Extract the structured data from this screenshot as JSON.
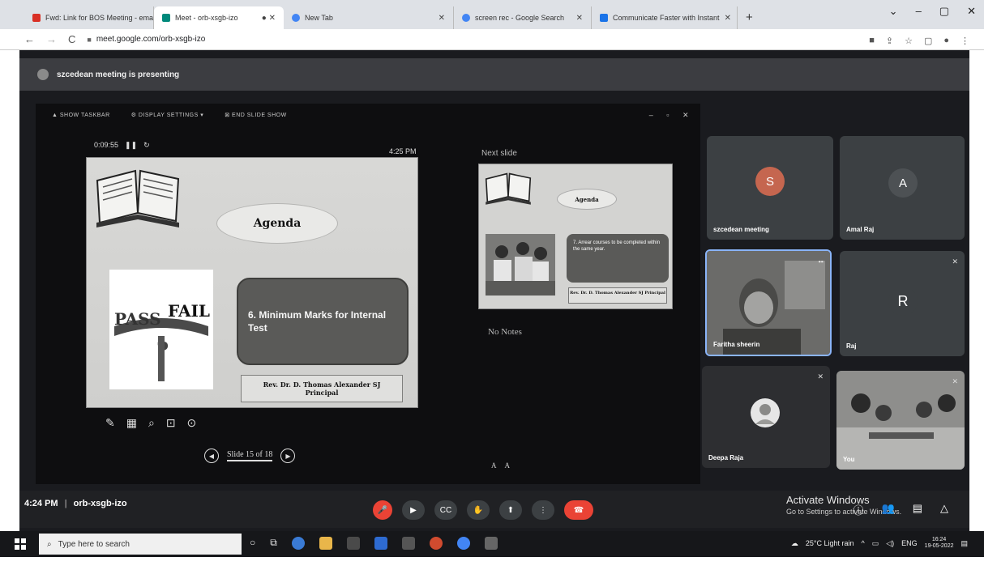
{
  "browser": {
    "tabs": [
      {
        "title": "Fwd: Link for BOS Meeting - ema",
        "icon": "gmail-icon",
        "color": "#d93025",
        "active": false
      },
      {
        "title": "Meet - orb-xsgb-izo",
        "icon": "meet-icon",
        "color": "#00897b",
        "active": true
      },
      {
        "title": "New Tab",
        "icon": "chrome-icon",
        "color": "#4285f4",
        "active": false
      },
      {
        "title": "screen rec - Google Search",
        "icon": "google-icon",
        "color": "#4285f4",
        "active": false
      },
      {
        "title": "Communicate Faster with Instant",
        "icon": "site-icon",
        "color": "#1a73e8",
        "active": false
      }
    ],
    "new_tab": "+",
    "url": "meet.google.com/orb-xsgb-izo",
    "window_controls": [
      "⌄",
      "–",
      "▢",
      "✕"
    ]
  },
  "meet": {
    "presenting_text": "szcedean meeting is presenting",
    "ppt_toolbar": {
      "show_taskbar": "SHOW TASKBAR",
      "display_settings": "DISPLAY SETTINGS ▾",
      "end_slide_show": "END SLIDE SHOW"
    },
    "timer": "0:09:55",
    "clock": "4:25 PM",
    "slide": {
      "title": "Agenda",
      "item": "6.  Minimum Marks for Internal Test",
      "pass_text": "PASS",
      "fail_text": "FAIL",
      "presenter_line1": "Rev. Dr. D. Thomas Alexander SJ",
      "presenter_line2": "Principal"
    },
    "slide_counter": "Slide 15 of 18",
    "next_slide_label": "Next slide",
    "next_slide": {
      "title": "Agenda",
      "item": "7. Arrear courses to be completed within the same year.",
      "presenter": "Rev. Dr. D. Thomas Alexander SJ Principal"
    },
    "notes": "No Notes",
    "font_buttons": [
      "A",
      "A"
    ],
    "participants": [
      {
        "name": "szcedean meeting",
        "initial": "S",
        "color": "#c5664f"
      },
      {
        "name": "Amal Raj",
        "initial": "A",
        "color": "#4d5154"
      },
      {
        "name": "Faritha sheerin",
        "initial": "",
        "color": ""
      },
      {
        "name": "Raj",
        "initial": "R",
        "color": "#3c4043"
      },
      {
        "name": "Deepa Raja",
        "initial": "",
        "color": ""
      },
      {
        "name": "You",
        "initial": "",
        "color": ""
      }
    ],
    "time": "4:24 PM",
    "meeting_code": "orb-xsgb-izo",
    "activate_title": "Activate Windows",
    "activate_sub": "Go to Settings to activate Windows."
  },
  "taskbar": {
    "search_placeholder": "Type here to search",
    "weather": "25°C  Light rain",
    "lang": "ENG",
    "time": "16:24",
    "date": "19-05-2022"
  },
  "colors": {
    "meet_bg": "#1a1b1f",
    "tile_bg": "#3c4043",
    "end_call": "#ea4335"
  }
}
